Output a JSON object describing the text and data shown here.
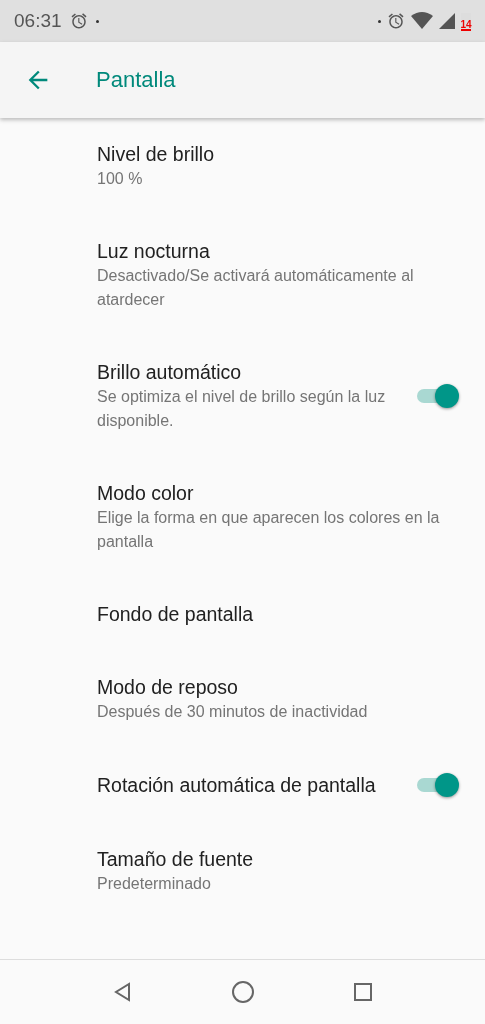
{
  "status_bar": {
    "time": "06:31",
    "battery_level_text": "14"
  },
  "app_bar": {
    "title": "Pantalla"
  },
  "settings": [
    {
      "title": "Nivel de brillo",
      "summary": "100 %"
    },
    {
      "title": "Luz nocturna",
      "summary": "Desactivado/Se activará automáticamente al atardecer"
    },
    {
      "title": "Brillo automático",
      "summary": "Se optimiza el nivel de brillo según la luz disponible.",
      "on": true
    },
    {
      "title": "Modo color",
      "summary": "Elige la forma en que aparecen los colores en la pantalla"
    },
    {
      "title": "Fondo de pantalla"
    },
    {
      "title": "Modo de reposo",
      "summary": "Después de 30 minutos de inactividad"
    },
    {
      "title": "Rotación automática de pantalla",
      "on": true
    },
    {
      "title": "Tamaño de fuente",
      "summary": "Predeterminado"
    }
  ]
}
